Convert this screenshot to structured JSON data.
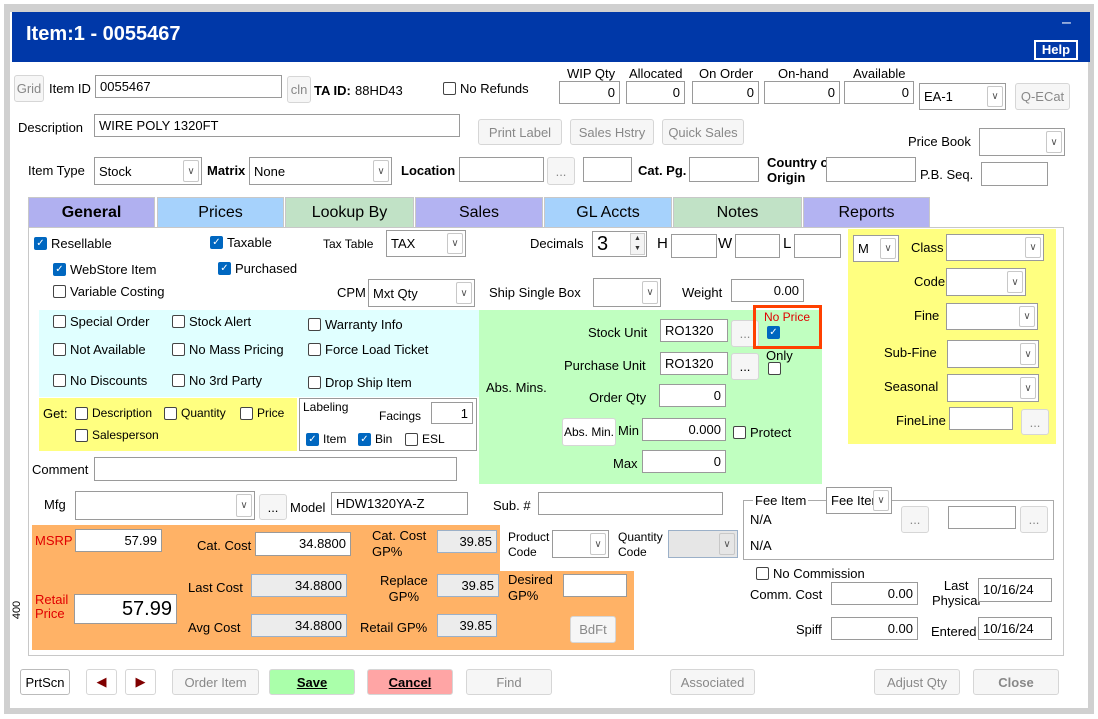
{
  "window": {
    "title": "Item:1 - 0055467",
    "help": "Help",
    "minimize": "–"
  },
  "header": {
    "grid": "Grid",
    "item_id_label": "Item ID",
    "item_id": "0055467",
    "cln": "cln",
    "ta_id_label": "TA ID:",
    "ta_id": "88HD43",
    "no_refunds": "No Refunds",
    "qty": [
      {
        "label": "WIP Qty",
        "value": "0"
      },
      {
        "label": "Allocated",
        "value": "0"
      },
      {
        "label": "On Order",
        "value": "0"
      },
      {
        "label": "On-hand",
        "value": "0"
      },
      {
        "label": "Available",
        "value": "0"
      }
    ],
    "unit": "EA-1",
    "qecat": "Q-ECat",
    "description_label": "Description",
    "description": "WIRE POLY 1320FT",
    "print_label": "Print Label",
    "sales_history": "Sales Hstry",
    "quick_sales": "Quick Sales",
    "price_book_label": "Price Book",
    "price_book": "",
    "item_type_label": "Item Type",
    "item_type": "Stock",
    "matrix_label": "Matrix",
    "matrix": "None",
    "location_label": "Location",
    "location": "",
    "dots": "...",
    "cat_pg_label": "Cat. Pg.",
    "country_label": "Country of",
    "country_label2": "Origin",
    "pb_seq_label": "P.B. Seq."
  },
  "tabs": [
    {
      "label": "General",
      "color": "#b0b0f0"
    },
    {
      "label": "Prices",
      "color": "#a6d2fc"
    },
    {
      "label": "Lookup By",
      "color": "#c1e2c6"
    },
    {
      "label": "Sales",
      "color": "#b3b3f2"
    },
    {
      "label": "GL Accts",
      "color": "#a6d2fc"
    },
    {
      "label": "Notes",
      "color": "#c1e2c6"
    },
    {
      "label": "Reports",
      "color": "#b3b3f2"
    }
  ],
  "general": {
    "resellable": "Resellable",
    "taxable": "Taxable",
    "tax_table_label": "Tax Table",
    "tax_table": "TAX",
    "decimals_label": "Decimals",
    "decimals": "3",
    "h": "H",
    "w": "W",
    "l": "L",
    "webstore": "WebStore Item",
    "purchased": "Purchased",
    "variable_costing": "Variable Costing",
    "cpm_label": "CPM",
    "cpm": "Mxt Qty",
    "ship_single_box": "Ship Single Box",
    "weight_label": "Weight",
    "weight": "0.00",
    "flags": [
      "Special Order",
      "Stock Alert",
      "Warranty Info",
      "Not Available",
      "No Mass Pricing",
      "Force Load Ticket",
      "No Discounts",
      "No 3rd Party",
      "Drop Ship Item"
    ],
    "get_label": "Get:",
    "get": [
      "Description",
      "Quantity",
      "Price",
      "Salesperson"
    ],
    "labeling": "Labeling",
    "facings_label": "Facings",
    "facings": "1",
    "label_item": "Item",
    "label_bin": "Bin",
    "label_esl": "ESL",
    "abs_mins": "Abs. Mins.",
    "stock_unit_label": "Stock Unit",
    "stock_unit": "RO1320",
    "purchase_unit_label": "Purchase Unit",
    "purchase_unit": "RO1320",
    "order_qty_label": "Order Qty",
    "order_qty": "0",
    "abs_min_btn": "Abs. Min.",
    "min_label": "Min",
    "min": "0.000",
    "protect": "Protect",
    "max_label": "Max",
    "max": "0",
    "no_price": "No Price",
    "only": "Only",
    "class_sel": "M",
    "class_label": "Class",
    "code_label": "Code",
    "fine_label": "Fine",
    "subfine_label": "Sub-Fine",
    "seasonal_label": "Seasonal",
    "fineline_label": "FineLine",
    "comment_label": "Comment",
    "mfg_label": "Mfg",
    "model_label": "Model",
    "model": "HDW1320YA-Z",
    "sub_label": "Sub. #",
    "fee_item_label": "Fee Item",
    "fee_item": "Fee Iter",
    "na1": "N/A",
    "na2": "N/A",
    "msrp_label": "MSRP",
    "msrp": "57.99",
    "cat_cost_label": "Cat. Cost",
    "cat_cost": "34.8800",
    "cat_gp_label1": "Cat. Cost",
    "cat_gp_label2": "GP%",
    "cat_gp": "39.85",
    "product_code_1": "Product",
    "product_code_2": "Code",
    "quantity_code_1": "Quantity",
    "quantity_code_2": "Code",
    "last_cost_label": "Last Cost",
    "last_cost": "34.8800",
    "replace_gp_1": "Replace",
    "replace_gp_2": "GP%",
    "replace_gp": "39.85",
    "desired_gp_1": "Desired",
    "desired_gp_2": "GP%",
    "retail_label_1": "Retail",
    "retail_label_2": "Price",
    "retail": "57.99",
    "avg_cost_label": "Avg Cost",
    "avg_cost": "34.8800",
    "retail_gp_label": "Retail GP%",
    "retail_gp": "39.85",
    "bdft": "BdFt",
    "side_number": "400",
    "no_commission": "No Commission",
    "comm_cost_label": "Comm. Cost",
    "comm_cost": "0.00",
    "last_physical_1": "Last",
    "last_physical_2": "Physical",
    "last_physical": "10/16/24",
    "spiff_label": "Spiff",
    "spiff": "0.00",
    "entered_label": "Entered",
    "entered": "10/16/24"
  },
  "footer": {
    "prtscn": "PrtScn",
    "order_item": "Order Item",
    "save": "Save",
    "cancel": "Cancel",
    "find": "Find",
    "associated": "Associated",
    "adjust_qty": "Adjust Qty",
    "close": "Close"
  },
  "colors": {
    "title_bar": "#0038a8",
    "cyan_panel": "#e0ffff",
    "green_panel": "#c0ffc0",
    "yellow_panel": "#ffff80",
    "orange_panel": "#ffb266",
    "no_price_highlight": "#ff4000",
    "save": "#aaffaa",
    "cancel": "#ffa5a5"
  }
}
